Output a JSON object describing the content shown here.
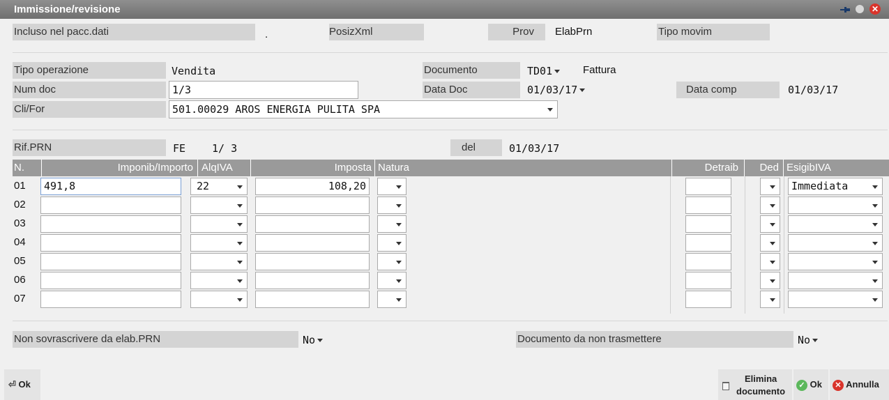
{
  "window": {
    "title": "Immissione/revisione"
  },
  "header": {
    "incluso_label": "Incluso nel pacc.dati",
    "incluso_value": ".",
    "posizxml_label": "PosizXml",
    "prov_label": "Prov",
    "prov_value": "ElabPrn",
    "tipo_movim_label": "Tipo movim"
  },
  "form": {
    "tipo_operazione_label": "Tipo operazione",
    "tipo_operazione_value": "Vendita",
    "documento_label": "Documento",
    "documento_code": "TD01",
    "documento_desc": "Fattura",
    "num_doc_label": "Num doc",
    "num_doc_value": "1/3",
    "data_doc_label": "Data Doc",
    "data_doc_value": "01/03/17",
    "data_comp_label": "Data comp",
    "data_comp_value": "01/03/17",
    "clifor_label": "Cli/For",
    "clifor_value": "501.00029 AROS ENERGIA PULITA SPA"
  },
  "rif": {
    "label": "Rif.PRN",
    "type": "FE",
    "number": "1/ 3",
    "del_label": "del",
    "del_value": "01/03/17"
  },
  "table": {
    "columns": [
      "N.",
      "Imponib/Importo",
      "AlqIVA",
      "Imposta",
      "Natura",
      "Detraib",
      "Ded",
      "EsigibIVA"
    ],
    "rows": [
      {
        "n": "01",
        "imponibile": "491,8",
        "aliquota": "22",
        "imposta": "108,20",
        "natura": "",
        "detraib": "",
        "ded": "",
        "esigib": "Immediata"
      },
      {
        "n": "02",
        "imponibile": "",
        "aliquota": "",
        "imposta": "",
        "natura": "",
        "detraib": "",
        "ded": "",
        "esigib": ""
      },
      {
        "n": "03",
        "imponibile": "",
        "aliquota": "",
        "imposta": "",
        "natura": "",
        "detraib": "",
        "ded": "",
        "esigib": ""
      },
      {
        "n": "04",
        "imponibile": "",
        "aliquota": "",
        "imposta": "",
        "natura": "",
        "detraib": "",
        "ded": "",
        "esigib": ""
      },
      {
        "n": "05",
        "imponibile": "",
        "aliquota": "",
        "imposta": "",
        "natura": "",
        "detraib": "",
        "ded": "",
        "esigib": ""
      },
      {
        "n": "06",
        "imponibile": "",
        "aliquota": "",
        "imposta": "",
        "natura": "",
        "detraib": "",
        "ded": "",
        "esigib": ""
      },
      {
        "n": "07",
        "imponibile": "",
        "aliquota": "",
        "imposta": "",
        "natura": "",
        "detraib": "",
        "ded": "",
        "esigib": ""
      }
    ]
  },
  "footer": {
    "non_sovrascrivere_label": "Non sovrascrivere da elab.PRN",
    "non_sovrascrivere_value": "No",
    "non_trasmettere_label": "Documento da non trasmettere",
    "non_trasmettere_value": "No"
  },
  "buttons": {
    "ok_left": "Ok",
    "elimina_line1": "Elimina",
    "elimina_line2": "documento",
    "ok": "Ok",
    "annulla": "Annulla"
  },
  "colors": {
    "titlebar": "#7f7f7f",
    "label_bg": "#d4d4d4",
    "table_header": "#9a9a9a",
    "close": "#d9342b",
    "ok_check": "#5cb85c"
  }
}
